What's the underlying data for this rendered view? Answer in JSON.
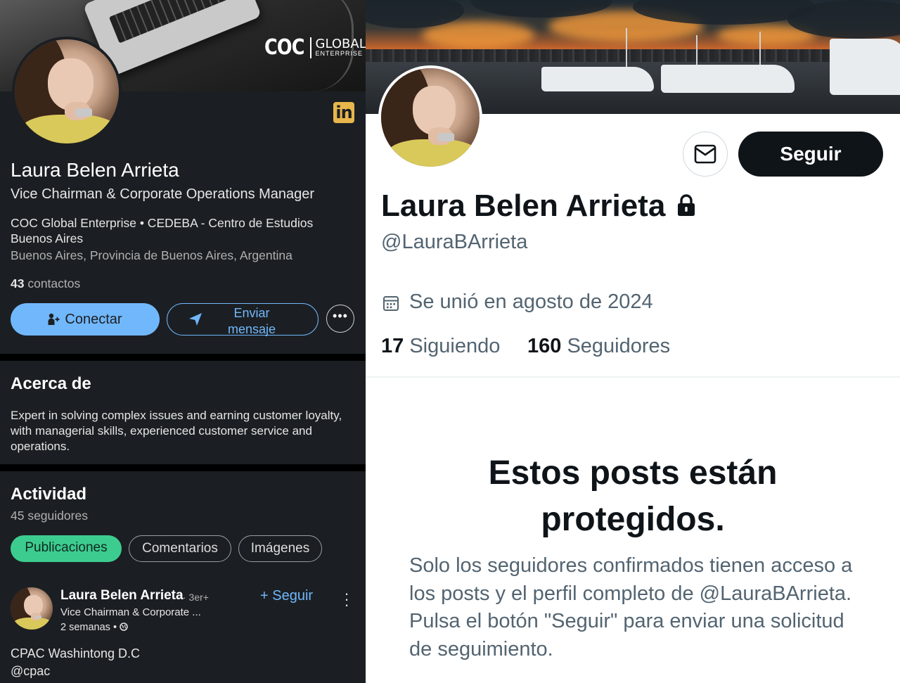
{
  "linkedin": {
    "banner": {
      "logo_mark": "COC",
      "logo_word": "GLOBAL",
      "logo_sub": "ENTERPRISE"
    },
    "brand_logo": "in",
    "name": "Laura Belen Arrieta",
    "headline": "Vice Chairman & Corporate Operations Manager",
    "company": "COC Global Enterprise • CEDEBA - Centro de Estudios Buenos Aires",
    "location": "Buenos Aires, Provincia de Buenos Aires, Argentina",
    "connections_count": "43",
    "connections_label": "contactos",
    "connect_label": "Conectar",
    "message_label": "Enviar mensaje",
    "more_label": "•••",
    "about": {
      "title": "Acerca de",
      "text": "Expert in solving complex issues and earning customer loyalty, with managerial skills, experienced customer service and operations."
    },
    "activity": {
      "title": "Actividad",
      "followers": "45 seguidores",
      "tabs": [
        "Publicaciones",
        "Comentarios",
        "Imágenes"
      ],
      "post": {
        "author": "Laura Belen Arrieta",
        "degree": "· 3er+",
        "headline": "Vice Chairman & Corporate ...",
        "time": "2 semanas •",
        "follow_label": "+ Seguir",
        "text_line1": "CPAC Washintong D.C",
        "text_line2": "@cpac"
      }
    },
    "colors": {
      "background": "#1b1f23",
      "accent": "#71b7fb",
      "active_tab": "#3dcc8f",
      "brand_logo": "#e8b64c"
    }
  },
  "x_profile": {
    "follow_label": "Seguir",
    "name": "Laura Belen Arrieta",
    "handle": "@LauraBArrieta",
    "joined": "Se unió en agosto de 2024",
    "following_count": "17",
    "following_label": "Siguiendo",
    "followers_count": "160",
    "followers_label": "Seguidores",
    "protected_title": "Estos posts están protegidos.",
    "protected_text": "Solo los seguidores confirmados tienen acceso a los posts y el perfil completo de @LauraBArrieta. Pulsa el botón \"Seguir\" para enviar una solicitud de seguimiento.",
    "icons": [
      "mail-icon",
      "lock-icon",
      "calendar-icon"
    ],
    "colors": {
      "primary_button": "#0f1419",
      "secondary_text": "#536471"
    }
  }
}
